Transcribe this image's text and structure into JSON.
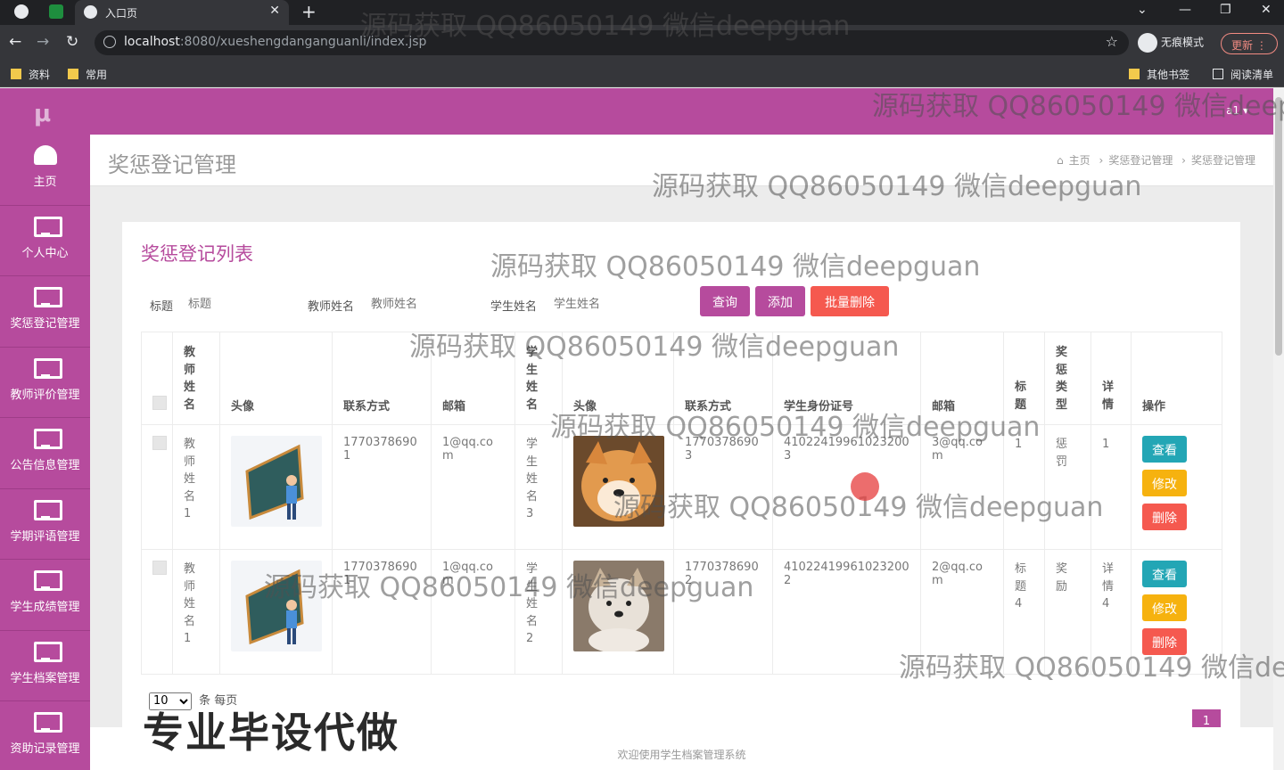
{
  "browser": {
    "tab_title": "入口页",
    "url_host": "localhost",
    "url_rest": ":8080/xueshengdanganguanli/index.jsp",
    "incognito_label": "无痕模式",
    "update_label": "更新",
    "bookmarks": [
      "资料",
      "常用"
    ],
    "bookmarks_right": [
      "其他书签",
      "阅读清单"
    ]
  },
  "app": {
    "user_label": "a1 ▾",
    "menu": [
      {
        "label": "主页",
        "icon": "dashboard-icon"
      },
      {
        "label": "个人中心",
        "icon": "monitor-icon"
      },
      {
        "label": "奖惩登记管理",
        "icon": "monitor-icon"
      },
      {
        "label": "教师评价管理",
        "icon": "monitor-icon"
      },
      {
        "label": "公告信息管理",
        "icon": "monitor-icon"
      },
      {
        "label": "学期评语管理",
        "icon": "monitor-icon"
      },
      {
        "label": "学生成绩管理",
        "icon": "monitor-icon"
      },
      {
        "label": "学生档案管理",
        "icon": "monitor-icon"
      },
      {
        "label": "资助记录管理",
        "icon": "monitor-icon"
      }
    ],
    "page_title": "奖惩登记管理",
    "breadcrumb": [
      "主页",
      "奖惩登记管理",
      "奖惩登记管理"
    ],
    "card_title": "奖惩登记列表",
    "search": {
      "title_label": "标题",
      "title_placeholder": "标题",
      "teacher_label": "教师姓名",
      "teacher_placeholder": "教师姓名",
      "student_label": "学生姓名",
      "student_placeholder": "学生姓名"
    },
    "buttons": {
      "query": "查询",
      "add": "添加",
      "batch_delete": "批量删除"
    },
    "columns": [
      "教师姓名",
      "头像",
      "联系方式",
      "邮箱",
      "学生姓名",
      "头像",
      "联系方式",
      "学生身份证号",
      "邮箱",
      "标题",
      "奖惩类型",
      "详情",
      "操作"
    ],
    "rows": [
      {
        "teacher_name": "教师姓名1",
        "teacher_phone": "17703786901",
        "teacher_email": "1@qq.com",
        "student_name": "学生姓名3",
        "student_phone": "17703786903",
        "student_id": "410224199610232003",
        "student_email": "3@qq.com",
        "title": "1",
        "type": "惩罚",
        "detail": "1"
      },
      {
        "teacher_name": "教师姓名1",
        "teacher_phone": "17703786901",
        "teacher_email": "1@qq.com",
        "student_name": "学生姓名2",
        "student_phone": "17703786902",
        "student_id": "410224199610232002",
        "student_email": "2@qq.com",
        "title": "标题4",
        "type": "奖励",
        "detail": "详情4"
      }
    ],
    "row_actions": {
      "view": "查看",
      "edit": "修改",
      "delete": "删除"
    },
    "pager": {
      "page_size": "10",
      "per_page_text": "条 每页",
      "current_page": "1"
    },
    "footer": "欢迎使用学生档案管理系统"
  },
  "overlay": {
    "watermark": "源码获取 QQ86050149 微信deepguan",
    "promo": "专业毕设代做"
  },
  "colors": {
    "brand": "#b64b9d",
    "query": "#b64b9d",
    "add": "#b64b9d",
    "danger": "#f5594f",
    "view": "#23a6b5",
    "edit": "#f6b20f"
  }
}
